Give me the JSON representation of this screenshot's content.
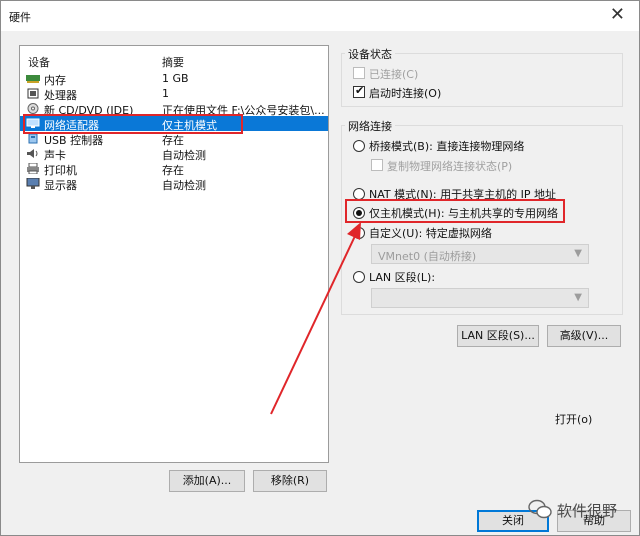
{
  "window": {
    "title": "硬件",
    "close_glyph": "✕"
  },
  "device_list": {
    "col_device": "设备",
    "col_summary": "摘要",
    "rows": [
      {
        "name": "内存",
        "summary": "1 GB",
        "icon": "memory-icon",
        "selected": false
      },
      {
        "name": "处理器",
        "summary": "1",
        "icon": "processor-icon",
        "selected": false
      },
      {
        "name": "新 CD/DVD (IDE)",
        "summary": "正在使用文件 F:\\公众号安装包\\...",
        "icon": "cd-dvd-icon",
        "selected": false
      },
      {
        "name": "网络适配器",
        "summary": "仅主机模式",
        "icon": "network-adapter-icon",
        "selected": true
      },
      {
        "name": "USB 控制器",
        "summary": "存在",
        "icon": "usb-icon",
        "selected": false
      },
      {
        "name": "声卡",
        "summary": "自动检测",
        "icon": "sound-card-icon",
        "selected": false
      },
      {
        "name": "打印机",
        "summary": "存在",
        "icon": "printer-icon",
        "selected": false
      },
      {
        "name": "显示器",
        "summary": "自动检测",
        "icon": "display-icon",
        "selected": false
      }
    ]
  },
  "buttons": {
    "add": "添加(A)...",
    "remove": "移除(R)",
    "lan_segments": "LAN 区段(S)...",
    "advanced": "高级(V)...",
    "close": "关闭",
    "help": "帮助"
  },
  "device_status": {
    "title": "设备状态",
    "connected": {
      "label": "已连接(C)",
      "checked": false,
      "disabled": true
    },
    "connect_at_power_on": {
      "label": "启动时连接(O)",
      "checked": true,
      "disabled": false
    }
  },
  "network_connection": {
    "title": "网络连接",
    "bridged": "桥接模式(B): 直接连接物理网络",
    "replicate_state": "复制物理网络连接状态(P)",
    "nat": "NAT 模式(N): 用于共享主机的 IP 地址",
    "host_only": "仅主机模式(H): 与主机共享的专用网络",
    "custom": "自定义(U): 特定虚拟网络",
    "custom_select_value": "VMnet0 (自动桥接)",
    "lan_segment": "LAN 区段(L):",
    "selected_mode": "host_only"
  },
  "open_label": "打开(o)",
  "watermark": "软件很野",
  "colors": {
    "selection": "#0a78d7",
    "highlight": "#e0262a"
  }
}
